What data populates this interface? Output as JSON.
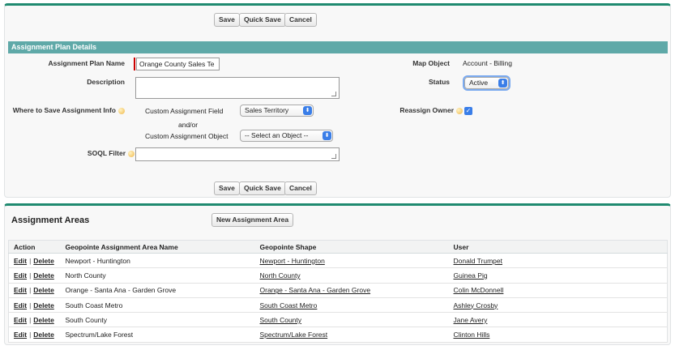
{
  "buttons": {
    "save": "Save",
    "quick_save": "Quick Save",
    "cancel": "Cancel",
    "new_area": "New Assignment Area"
  },
  "details": {
    "header": "Assignment Plan Details",
    "plan_name_label": "Assignment Plan Name",
    "plan_name_value": "Orange County Sales Te",
    "description_label": "Description",
    "description_value": "",
    "where_label": "Where to Save Assignment Info",
    "custom_field_label": "Custom Assignment Field",
    "custom_field_value": "Sales Territory",
    "and_or": "and/or",
    "custom_object_label": "Custom Assignment Object",
    "custom_object_value": "-- Select an Object --",
    "soql_label": "SOQL Filter",
    "soql_value": "",
    "map_object_label": "Map Object",
    "map_object_value": "Account - Billing",
    "status_label": "Status",
    "status_value": "Active",
    "reassign_label": "Reassign Owner",
    "reassign_checked": true
  },
  "areas": {
    "title": "Assignment Areas",
    "columns": [
      "Action",
      "Geopointe Assignment Area Name",
      "Geopointe Shape",
      "User"
    ],
    "edit": "Edit",
    "delete": "Delete",
    "divider": "|",
    "rows": [
      {
        "name": "Newport - Huntington",
        "shape": "Newport - Huntington",
        "user": "Donald Trumpet"
      },
      {
        "name": "North County",
        "shape": "North County",
        "user": "Guinea Pig"
      },
      {
        "name": "Orange - Santa Ana - Garden Grove",
        "shape": "Orange - Santa Ana - Garden Grove",
        "user": "Colin McDonnell"
      },
      {
        "name": "South Coast Metro",
        "shape": "South Coast Metro",
        "user": "Ashley Crosby"
      },
      {
        "name": "South County",
        "shape": "South County",
        "user": "Jane Avery"
      },
      {
        "name": "Spectrum/Lake Forest",
        "shape": "Spectrum/Lake Forest",
        "user": "Clinton Hills"
      }
    ]
  },
  "colors": {
    "accent": "#1f8a70",
    "section_header": "#5fa9a8",
    "select_arrow": "#3a7ee8",
    "required": "#cc0000"
  }
}
